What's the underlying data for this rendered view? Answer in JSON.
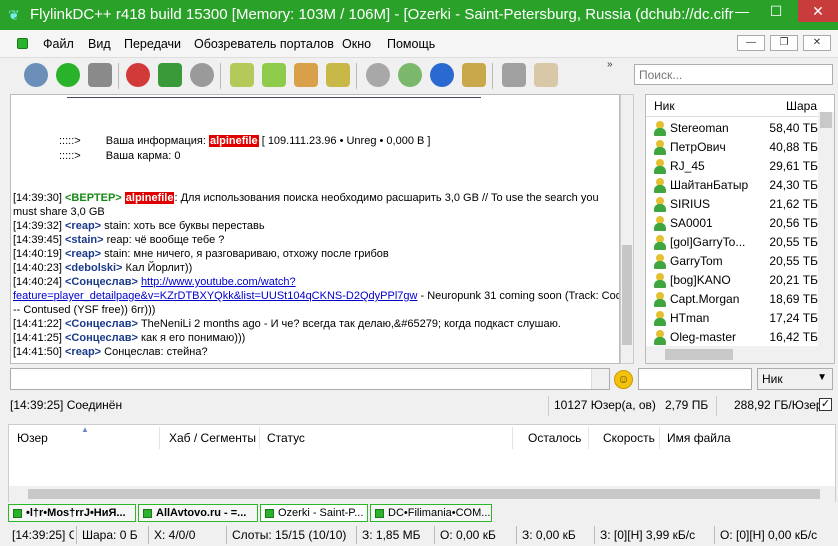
{
  "window": {
    "title": "FlylinkDC++ r418 build 15300 [Memory: 103M / 106M] - [Ozerki - Saint-Petersburg, Russia (dchub://dc.cifr"
  },
  "menu": [
    "Файл",
    "Вид",
    "Передачи",
    "Обозреватель порталов",
    "Окно",
    "Помощь"
  ],
  "toolbar": {
    "more": "»",
    "buttons": [
      "connect-icon",
      "reconnect-icon",
      "follow-icon",
      "favorites-icon",
      "users-icon",
      "recent-icon",
      "queue-icon",
      "finished-icon",
      "upload-icon",
      "finished-uploads-icon",
      "search-icon",
      "adl-search-icon",
      "search-spy-icon",
      "notepad-icon",
      "settings-icon",
      "open-list-icon"
    ],
    "colors": {
      "green": "#2bb22b",
      "blue": "#2a6ad0",
      "red": "#d23a3a",
      "gray": "#8a8a8a"
    }
  },
  "search": {
    "placeholder": "Поиск..."
  },
  "chat": {
    "info": {
      "prefix": ":::::>",
      "label": "Ваша информация:",
      "nick": "alpinefile",
      "details": "[ 109.111.23.96 • Unreg • 0,000 B ]",
      "karma": "Ваша карма: 0"
    },
    "lines": [
      {
        "ts": "[14:39:30]",
        "nick": "<ВЕРТЕР>",
        "hl": "alpinefile",
        "text": ": Для использования поиска необходимо расшарить 3,0 GB // To use the search you"
      },
      {
        "ts": "",
        "nick": "",
        "hl": "",
        "text": "must share 3,0 GB"
      },
      {
        "ts": "[14:39:32]",
        "nick": "<reap>",
        "hl": "",
        "text": "stain: хоть все буквы переставь"
      },
      {
        "ts": "[14:39:45]",
        "nick": "<stain>",
        "hl": "",
        "text": "reap: чё вообще тебе ?"
      },
      {
        "ts": "[14:40:19]",
        "nick": "<reap>",
        "hl": "",
        "text": "stain: мне ничего, я разговариваю, отхожу после грибов"
      },
      {
        "ts": "[14:40:23]",
        "nick": "<debolski>",
        "hl": "",
        "text": "Кал Йорлит))"
      },
      {
        "ts": "[14:40:24]",
        "nick": "<Сонцеслав>",
        "hl": "",
        "text": "",
        "link": "http://www.youtube.com/watch?"
      },
      {
        "ts": "",
        "nick": "",
        "hl": "",
        "text": " - Neuropunk 31 coming soon (Track: Cod3x",
        "link": "feature=player_detailpage&v=KZrDTBXYQkk&list=UUSt104qCKNS-D2QdyPPl7gw"
      },
      {
        "ts": "",
        "nick": "",
        "hl": "",
        "text": "-- Contused (YSF free)) 6rr)))"
      },
      {
        "ts": "[14:41:22]",
        "nick": "<Сонцеслав>",
        "hl": "",
        "text": "TheNeniLi 2 months ago - И че? всегда так делаю,&#65279; когда подкаст слушаю."
      },
      {
        "ts": "[14:41:25]",
        "nick": "<Сонцеслав>",
        "hl": "",
        "text": "как я его понимаю)))"
      },
      {
        "ts": "[14:41:50]",
        "nick": "<reap>",
        "hl": "",
        "text": "Сонцеслав: стейна?"
      }
    ]
  },
  "userlist": {
    "col_nick": "Ник",
    "col_share": "Шара",
    "users": [
      {
        "nick": "Stereoman",
        "share": "58,40 ТБ"
      },
      {
        "nick": "ПетрОвич",
        "share": "40,88 ТБ"
      },
      {
        "nick": "RJ_45",
        "share": "29,61 ТБ"
      },
      {
        "nick": "ШайтанБатыр",
        "share": "24,30 ТБ"
      },
      {
        "nick": "SIRIUS",
        "share": "21,62 ТБ"
      },
      {
        "nick": "SA0001",
        "share": "20,56 ТБ"
      },
      {
        "nick": "[gol]GarryTo...",
        "share": "20,55 ТБ"
      },
      {
        "nick": "GarryTom",
        "share": "20,55 ТБ"
      },
      {
        "nick": "[bog]KANO",
        "share": "20,21 ТБ"
      },
      {
        "nick": "Capt.Morgan",
        "share": "18,69 ТБ"
      },
      {
        "nick": "HTman",
        "share": "17,24 ТБ"
      },
      {
        "nick": "Oleg-master",
        "share": "16,42 ТБ"
      }
    ]
  },
  "filter": {
    "select": "Ник"
  },
  "status1": {
    "message": "[14:39:25] Соединён",
    "users": "10127 Юзер(а, ов)",
    "share": "2,79 ПБ",
    "per_user": "288,92 ГБ/Юзер",
    "check": "✓"
  },
  "transfers": {
    "headers": [
      "Юзер",
      "Хаб / Сегменты",
      "Статус",
      "Осталось",
      "Скорость",
      "Имя файла"
    ]
  },
  "hubtabs": [
    "•l†r•Mos†rrJ•HиЯ...",
    "AllAvtovo.ru - =...",
    "Ozerki - Saint-P...",
    "DC•Filimania•COM..."
  ],
  "status2": [
    "[14:39:25] Сл",
    "Шара: 0 Б",
    "Х: 4/0/0",
    "Слоты: 15/15 (10/10)",
    "З: 1,85 МБ",
    "О: 0,00 кБ",
    "З: 0,00 кБ",
    "З: [0][Н] 3,99 кБ/с",
    "О: [0][Н] 0,00 кБ/с"
  ]
}
